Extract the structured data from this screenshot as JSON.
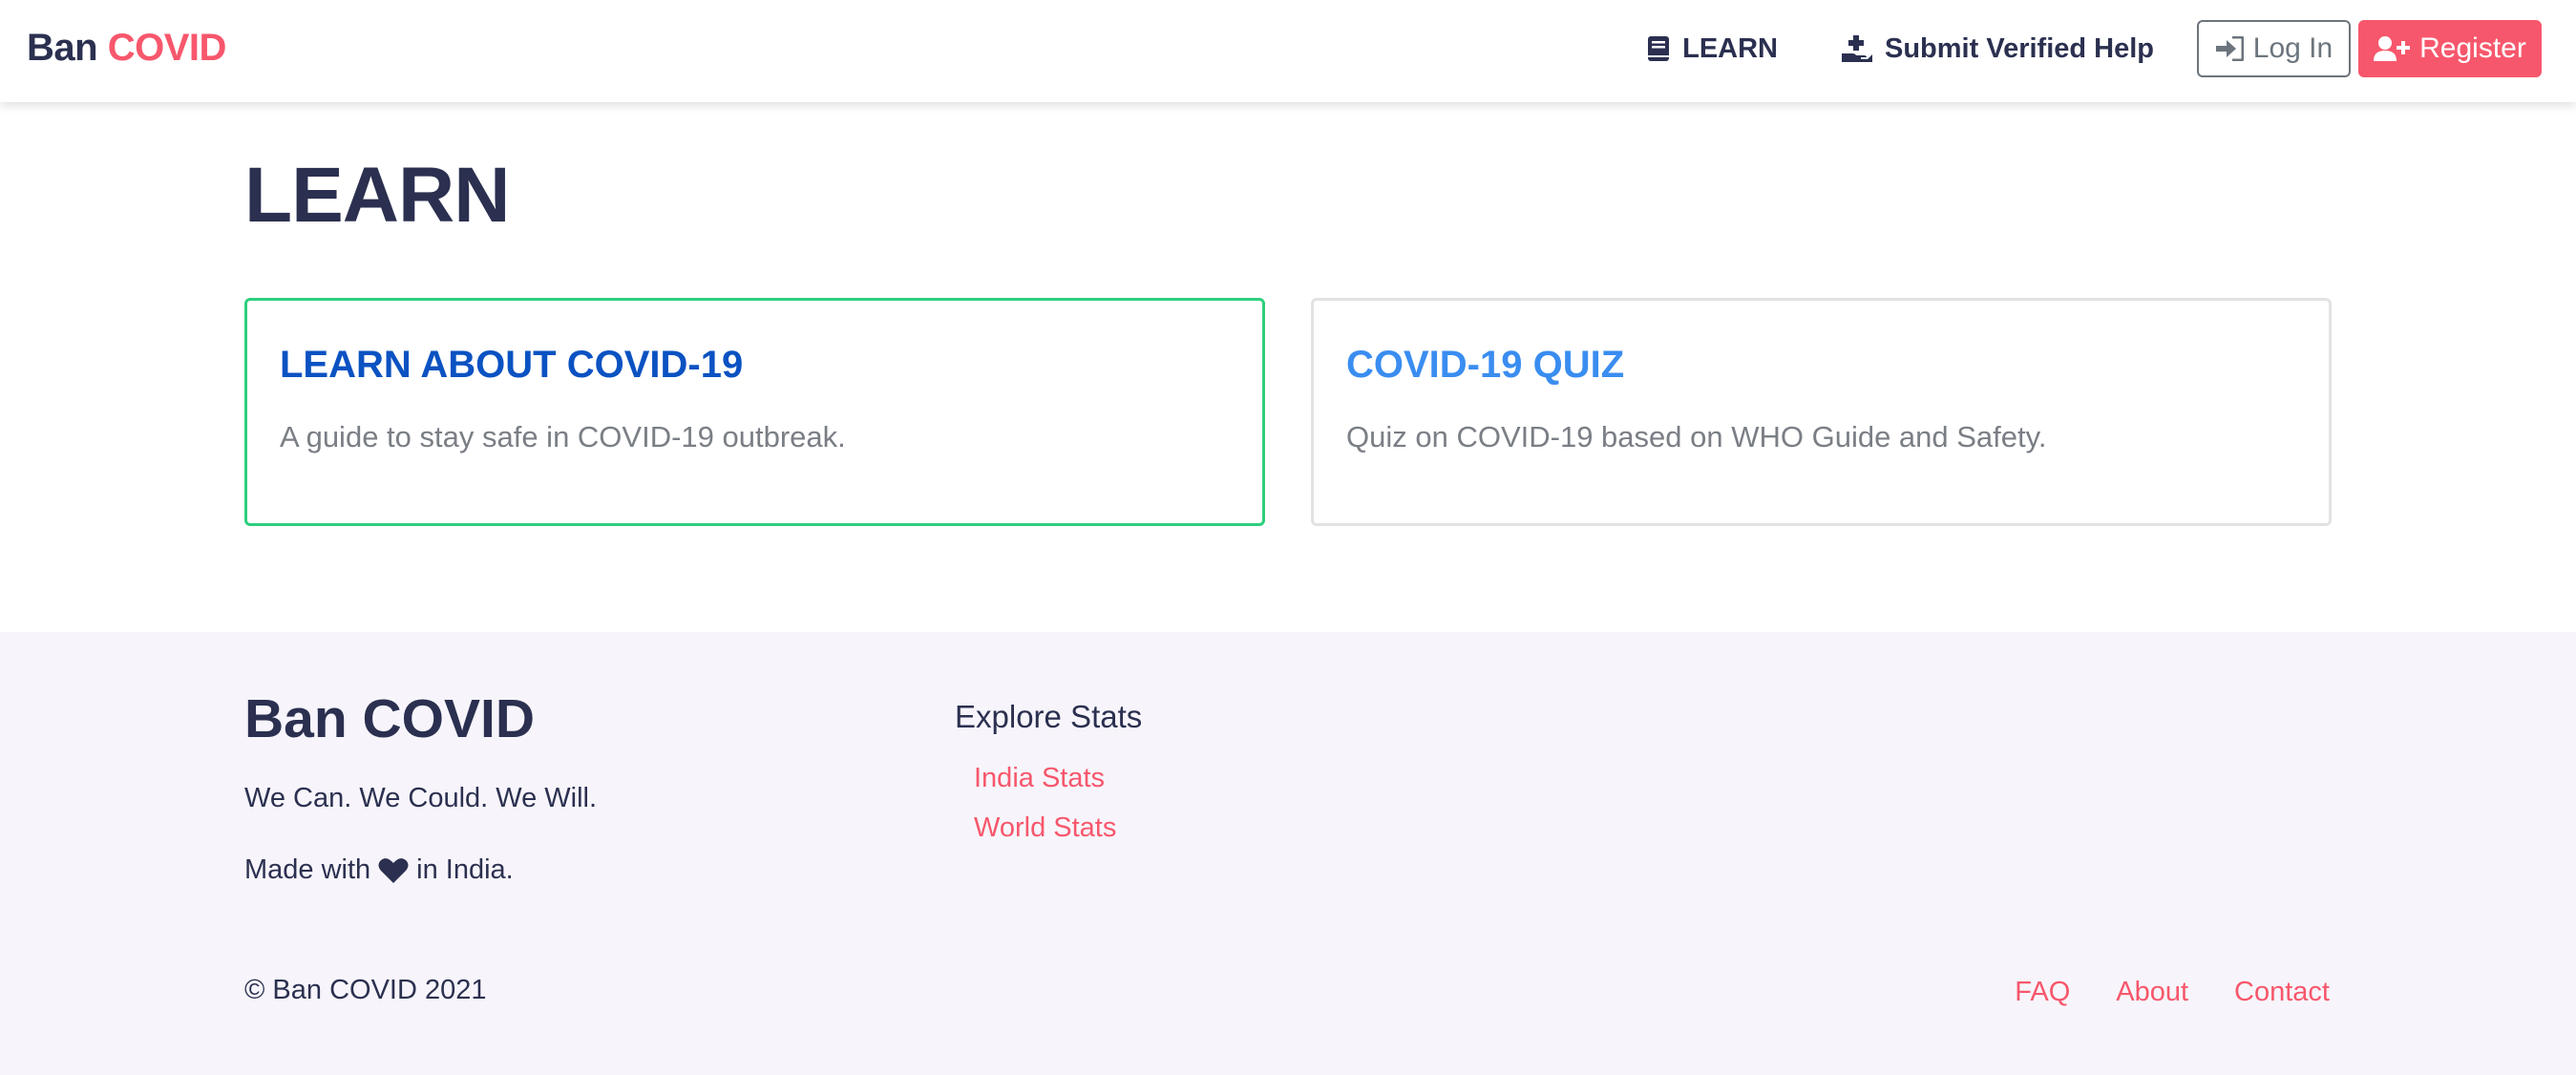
{
  "navbar": {
    "brand_main": "Ban",
    "brand_accent": "COVID",
    "links": {
      "learn": "LEARN",
      "submit_help": "Submit Verified Help"
    },
    "login_label": "Log In",
    "register_label": "Register"
  },
  "main": {
    "title": "LEARN",
    "cards": [
      {
        "title": "LEARN ABOUT COVID-19",
        "text": "A guide to stay safe in COVID-19 outbreak."
      },
      {
        "title": "COVID-19 QUIZ",
        "text": "Quiz on COVID-19 based on WHO Guide and Safety."
      }
    ]
  },
  "footer": {
    "brand": "Ban COVID",
    "tagline": "We Can. We Could. We Will.",
    "made_prefix": "Made with",
    "made_suffix": "in India.",
    "explore_title": "Explore Stats",
    "stats_links": [
      "India Stats",
      "World Stats"
    ],
    "copyright": "© Ban COVID 2021",
    "bottom_links": [
      "FAQ",
      "About",
      "Contact"
    ]
  },
  "colors": {
    "accent": "#f7576c",
    "dark": "#2b3050",
    "card_active_border": "#2ecf7e",
    "card_title_dark_blue": "#0b52c2",
    "card_title_light_blue": "#3a8df0"
  },
  "icons": {
    "learn": "book-icon",
    "submit_help": "hand-plus-icon",
    "login": "sign-in-icon",
    "register": "user-plus-icon",
    "made_with": "heart-icon"
  }
}
